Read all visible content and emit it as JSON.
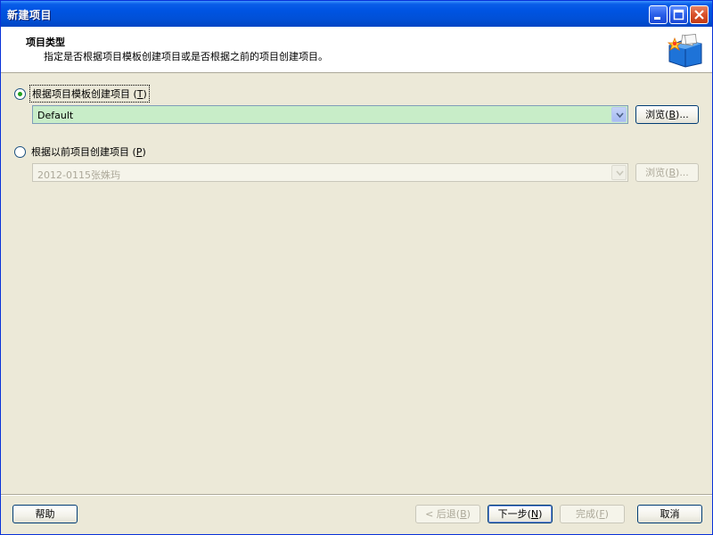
{
  "window": {
    "title": "新建项目"
  },
  "header": {
    "title": "项目类型",
    "description": "指定是否根据项目模板创建项目或是否根据之前的项目创建项目。",
    "icon": "new-project-folder-icon"
  },
  "options": {
    "template": {
      "label": "根据项目模板创建项目",
      "key": "T",
      "selected": true,
      "combo_value": "Default",
      "browse_label": "浏览",
      "browse_key": "B",
      "browse_suffix": "..."
    },
    "previous": {
      "label": "根据以前项目创建项目",
      "key": "P",
      "selected": false,
      "combo_value": "2012-0115张姝玙",
      "browse_label": "浏览",
      "browse_key": "B",
      "browse_suffix": "..."
    }
  },
  "footer": {
    "help": "帮助",
    "back": "< 后退",
    "back_key": "B",
    "next": "下一步",
    "next_key": "N",
    "finish": "完成",
    "finish_key": "F",
    "cancel": "取消"
  },
  "colors": {
    "titlebar": "#0054e3",
    "active_combo": "#c8edc8",
    "dialog_bg": "#ece9d8"
  }
}
